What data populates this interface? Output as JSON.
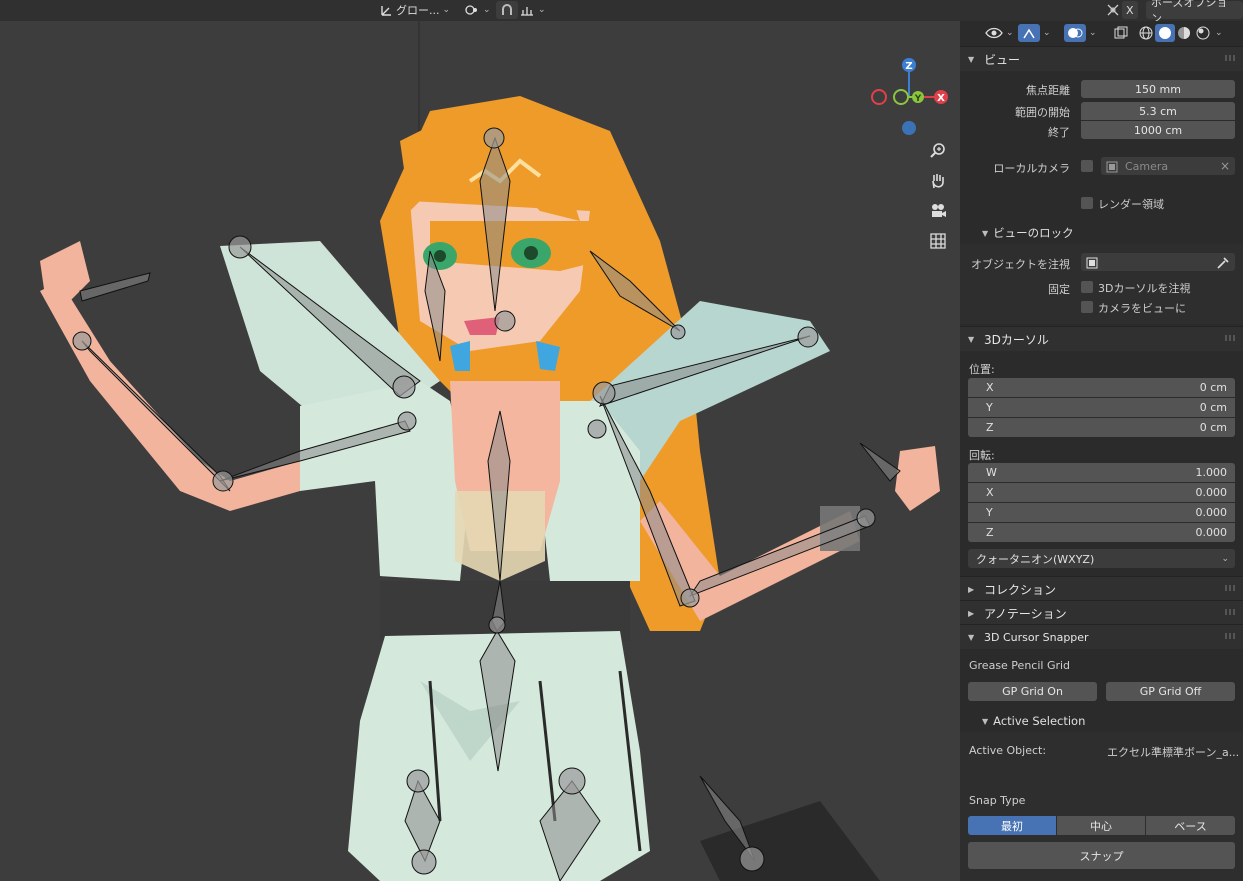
{
  "header": {
    "transform_orientation": "グロー...",
    "pose_options": "ポーズオプション",
    "x_label": "X"
  },
  "sidebar": {
    "view": {
      "title": "ビュー",
      "focal_length_label": "焦点距離",
      "focal_length": "150 mm",
      "clip_start_label": "範囲の開始",
      "clip_start": "5.3 cm",
      "clip_end_label": "終了",
      "clip_end": "1000 cm",
      "local_camera_label": "ローカルカメラ",
      "local_camera_value": "Camera",
      "render_region_label": "レンダー領域",
      "view_lock": {
        "title": "ビューのロック",
        "lock_to_object_label": "オブジェクトを注視",
        "lock_label": "固定",
        "lock_cursor_label": "3Dカーソルを注視",
        "camera_to_view_label": "カメラをビューに"
      }
    },
    "cursor": {
      "title": "3Dカーソル",
      "location_label": "位置:",
      "location": [
        {
          "axis": "X",
          "value": "0 cm"
        },
        {
          "axis": "Y",
          "value": "0 cm"
        },
        {
          "axis": "Z",
          "value": "0 cm"
        }
      ],
      "rotation_label": "回転:",
      "rotation": [
        {
          "axis": "W",
          "value": "1.000"
        },
        {
          "axis": "X",
          "value": "0.000"
        },
        {
          "axis": "Y",
          "value": "0.000"
        },
        {
          "axis": "Z",
          "value": "0.000"
        }
      ],
      "rotation_mode": "クォータニオン(WXYZ)"
    },
    "collection": {
      "title": "コレクション"
    },
    "annotation": {
      "title": "アノテーション"
    },
    "snapper": {
      "title": "3D Cursor Snapper",
      "gp_grid_label": "Grease Pencil Grid",
      "gp_grid_on": "GP Grid On",
      "gp_grid_off": "GP Grid Off",
      "active_selection_title": "Active Selection",
      "active_object_label": "Active Object:",
      "active_object_value": "エクセル準標準ボーン_a...",
      "snap_type_label": "Snap Type",
      "snap_types": [
        "最初",
        "中心",
        "ベース"
      ],
      "snap_button": "スナップ"
    }
  },
  "gizmo": {
    "z": "Z",
    "y": "Y",
    "x": "X"
  },
  "colors": {
    "accent": "#4772b3",
    "axis_x": "#e0404a",
    "axis_y": "#8cc63e",
    "axis_z": "#3b7fd4"
  }
}
